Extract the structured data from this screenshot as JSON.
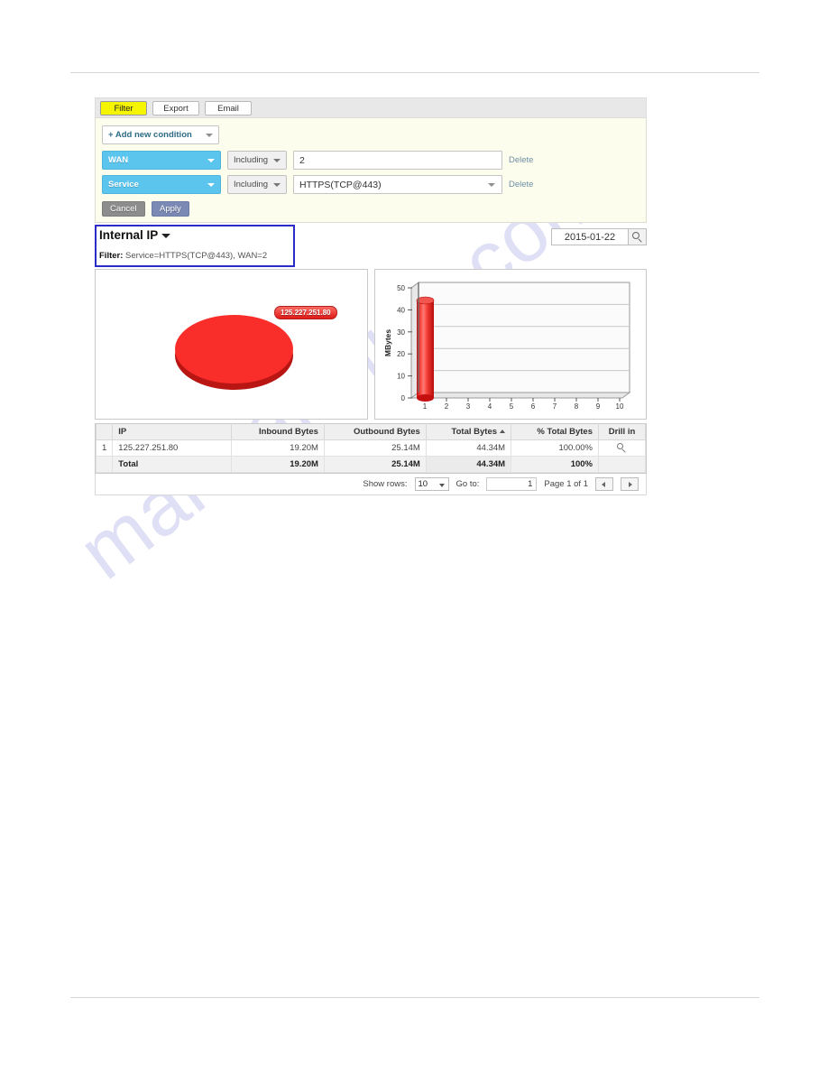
{
  "watermark": {
    "text": "manualshive.com"
  },
  "toolbar": {
    "filter_label": "Filter",
    "export_label": "Export",
    "email_label": "Email"
  },
  "filter_panel": {
    "add_condition_label": "+ Add new condition",
    "conditions": [
      {
        "field": "WAN",
        "operator": "Including",
        "value": "2",
        "delete_label": "Delete"
      },
      {
        "field": "Service",
        "operator": "Including",
        "value": "HTTPS(TCP@443)",
        "delete_label": "Delete"
      }
    ],
    "cancel_label": "Cancel",
    "apply_label": "Apply"
  },
  "report": {
    "title": "Internal IP",
    "filter_prefix": "Filter:",
    "filter_summary": "Service=HTTPS(TCP@443), WAN=2",
    "date": "2015-01-22"
  },
  "chart_data": [
    {
      "type": "pie",
      "title": "",
      "labels": [
        "125.227.251.80"
      ],
      "values": [
        100
      ],
      "unit": "%",
      "colors": [
        "#f92e2b"
      ],
      "legend_position": "inline-label"
    },
    {
      "type": "bar",
      "title": "",
      "xlabel": "",
      "ylabel": "MBytes",
      "categories": [
        "1",
        "2",
        "3",
        "4",
        "5",
        "6",
        "7",
        "8",
        "9",
        "10"
      ],
      "values": [
        44.34,
        0,
        0,
        0,
        0,
        0,
        0,
        0,
        0,
        0
      ],
      "ylim": [
        0,
        50
      ],
      "yticks": [
        0,
        10,
        20,
        30,
        40,
        50
      ],
      "grid": true,
      "series_color": "#e82e2b"
    }
  ],
  "table": {
    "columns": [
      "",
      "IP",
      "Inbound Bytes",
      "Outbound Bytes",
      "Total Bytes",
      "% Total Bytes",
      "Drill in"
    ],
    "sorted_column": "Total Bytes",
    "sort_direction": "asc",
    "rows": [
      {
        "num": "1",
        "ip": "125.227.251.80",
        "inbound": "19.20M",
        "outbound": "25.14M",
        "total": "44.34M",
        "percent": "100.00%",
        "drill_icon": "magnifier-icon"
      }
    ],
    "total_row": {
      "label": "Total",
      "inbound": "19.20M",
      "outbound": "25.14M",
      "total": "44.34M",
      "percent": "100%"
    }
  },
  "pager": {
    "show_rows_label": "Show rows:",
    "show_rows_value": "10",
    "goto_label": "Go to:",
    "goto_value": "1",
    "page_info": "Page 1 of 1"
  }
}
